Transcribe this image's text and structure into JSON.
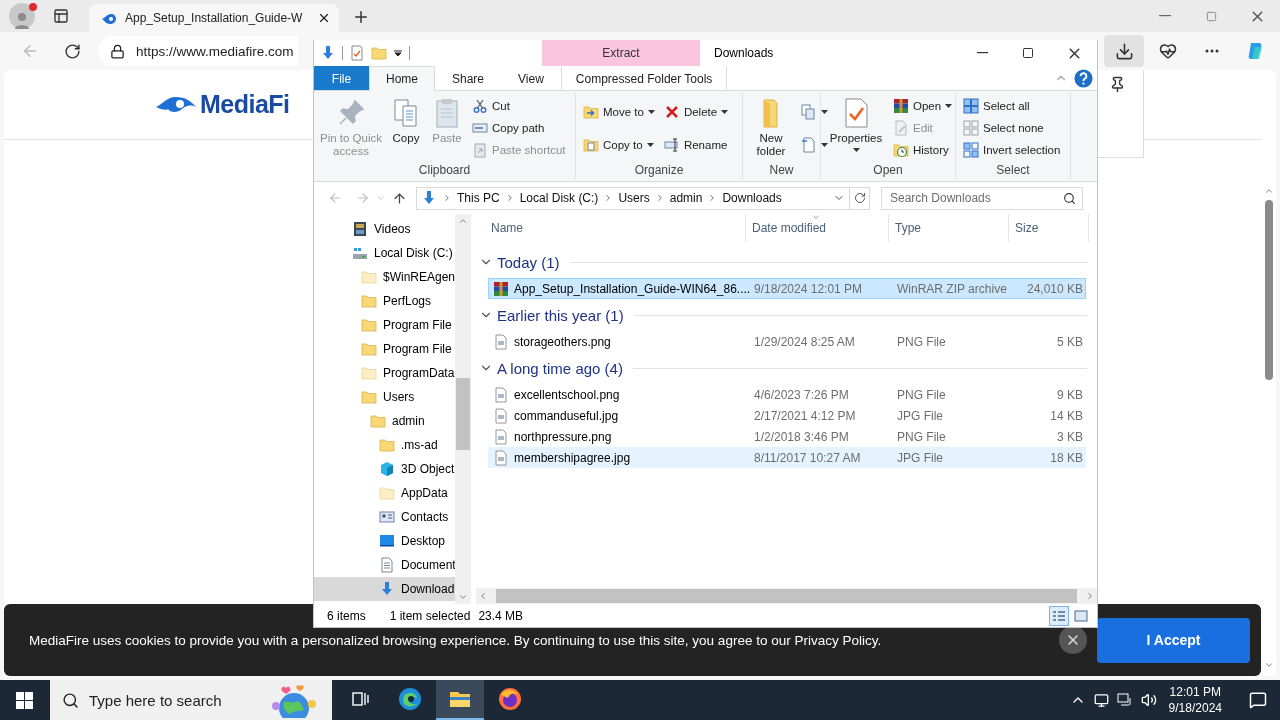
{
  "browser": {
    "tabs": [
      {
        "title": "App_Setup_Installation_Guide-W",
        "selected": true
      }
    ],
    "url": "https://www.mediafire.com"
  },
  "page": {
    "logo": "MediaFi"
  },
  "cookie_banner": {
    "text": "MediaFire uses cookies to provide you with a personalized browsing experience. By continuing to use this site, you agree to our Privacy Policy.",
    "button": "I Accept"
  },
  "explorer": {
    "title": "Downloads",
    "context_group": "Extract",
    "tabs": [
      {
        "label": "File",
        "kind": "file",
        "selected": false
      },
      {
        "label": "Home",
        "kind": "tab",
        "selected": true
      },
      {
        "label": "Share",
        "kind": "tab",
        "selected": false
      },
      {
        "label": "View",
        "kind": "tab",
        "selected": false
      },
      {
        "label": "Compressed Folder Tools",
        "kind": "contextual",
        "selected": false
      }
    ],
    "ribbon": [
      {
        "label": "Clipboard",
        "columns": [
          [
            {
              "kind": "large",
              "label": "Pin to Quick access",
              "disabled": true
            }
          ],
          [
            {
              "kind": "large",
              "label": "Copy",
              "disabled": false
            }
          ],
          [
            {
              "kind": "large",
              "label": "Paste",
              "disabled": true
            }
          ],
          [
            {
              "kind": "small",
              "label": "Cut",
              "disabled": false
            },
            {
              "kind": "small",
              "label": "Copy path",
              "disabled": false
            },
            {
              "kind": "small",
              "label": "Paste shortcut",
              "disabled": true
            }
          ]
        ]
      },
      {
        "label": "Organize",
        "columns": [
          [
            {
              "kind": "small",
              "label": "Move to",
              "disabled": false,
              "dropdown": true
            },
            {
              "kind": "small",
              "label": "Copy to",
              "disabled": false,
              "dropdown": true
            }
          ],
          [
            {
              "kind": "small",
              "label": "Delete",
              "disabled": false,
              "dropdown": true
            },
            {
              "kind": "small",
              "label": "Rename",
              "disabled": false
            }
          ]
        ]
      },
      {
        "label": "New",
        "columns": [
          [
            {
              "kind": "large",
              "label": "New folder",
              "disabled": false
            }
          ],
          [
            {
              "kind": "icon",
              "disabled": false,
              "dropdown": true
            },
            {
              "kind": "icon",
              "disabled": false,
              "dropdown": true
            }
          ]
        ]
      },
      {
        "label": "Open",
        "columns": [
          [
            {
              "kind": "large",
              "label": "Properties",
              "disabled": false,
              "dropdown": true
            }
          ],
          [
            {
              "kind": "small",
              "label": "Open",
              "disabled": false,
              "dropdown": true
            },
            {
              "kind": "small",
              "label": "Edit",
              "disabled": true
            },
            {
              "kind": "small",
              "label": "History",
              "disabled": false
            }
          ]
        ]
      },
      {
        "label": "Select",
        "columns": [
          [
            {
              "kind": "small",
              "label": "Select all",
              "disabled": false
            },
            {
              "kind": "small",
              "label": "Select none",
              "disabled": false
            },
            {
              "kind": "small",
              "label": "Invert selection",
              "disabled": false
            }
          ]
        ]
      }
    ],
    "address": {
      "crumbs": [
        "This PC",
        "Local Disk (C:)",
        "Users",
        "admin",
        "Downloads"
      ],
      "search_placeholder": "Search Downloads"
    },
    "nav": [
      {
        "label": "Videos",
        "kind": "videos",
        "selected": false
      },
      {
        "label": "Local Disk (C:)",
        "kind": "drive",
        "selected": false,
        "children": [
          {
            "label": "$WinREAgen",
            "kind": "folder",
            "hidden": true,
            "selected": false
          },
          {
            "label": "PerfLogs",
            "kind": "folder",
            "hidden": false,
            "selected": false
          },
          {
            "label": "Program File",
            "kind": "folder",
            "hidden": false,
            "selected": false
          },
          {
            "label": "Program File",
            "kind": "folder",
            "hidden": false,
            "selected": false
          },
          {
            "label": "ProgramData",
            "kind": "folder",
            "hidden": true,
            "selected": false
          },
          {
            "label": "Users",
            "kind": "folder",
            "hidden": false,
            "selected": false,
            "children": [
              {
                "label": "admin",
                "kind": "folder",
                "hidden": false,
                "selected": false,
                "children": [
                  {
                    "label": ".ms-ad",
                    "kind": "folder",
                    "hidden": false,
                    "selected": false
                  },
                  {
                    "label": "3D Object",
                    "kind": "objects",
                    "selected": false
                  },
                  {
                    "label": "AppData",
                    "kind": "folder",
                    "hidden": true,
                    "selected": false
                  },
                  {
                    "label": "Contacts",
                    "kind": "contacts",
                    "selected": false
                  },
                  {
                    "label": "Desktop",
                    "kind": "desktop",
                    "selected": false
                  },
                  {
                    "label": "Document",
                    "kind": "documents",
                    "selected": false
                  },
                  {
                    "label": "Download",
                    "kind": "downloads",
                    "selected": true
                  }
                ]
              }
            ]
          }
        ]
      }
    ],
    "columns": [
      "Name",
      "Date modified",
      "Type",
      "Size"
    ],
    "groups": [
      {
        "title": "Today (1)",
        "expanded": true,
        "files": [
          {
            "name": "App_Setup_Installation_Guide-WIN64_86....",
            "date": "9/18/2024 12:01 PM",
            "type": "WinRAR ZIP archive",
            "size": "24,010 KB",
            "kind": "archive",
            "selected": true,
            "hovered": false
          }
        ]
      },
      {
        "title": "Earlier this year (1)",
        "expanded": true,
        "files": [
          {
            "name": "storageothers.png",
            "date": "1/29/2024 8:25 AM",
            "type": "PNG File",
            "size": "5 KB",
            "kind": "image",
            "selected": false,
            "hovered": false
          }
        ]
      },
      {
        "title": "A long time ago (4)",
        "expanded": true,
        "files": [
          {
            "name": "excellentschool.png",
            "date": "4/6/2023 7:26 PM",
            "type": "PNG File",
            "size": "9 KB",
            "kind": "image",
            "selected": false,
            "hovered": false
          },
          {
            "name": "commanduseful.jpg",
            "date": "2/17/2021 4:12 PM",
            "type": "JPG File",
            "size": "14 KB",
            "kind": "image",
            "selected": false,
            "hovered": false
          },
          {
            "name": "northpressure.png",
            "date": "1/2/2018 3:46 PM",
            "type": "PNG File",
            "size": "3 KB",
            "kind": "image",
            "selected": false,
            "hovered": false
          },
          {
            "name": "membershipagree.jpg",
            "date": "8/11/2017 10:27 AM",
            "type": "JPG File",
            "size": "18 KB",
            "kind": "image",
            "selected": false,
            "hovered": true
          }
        ]
      }
    ],
    "status": {
      "count": "6 items",
      "selection": "1 item selected",
      "size": "23.4 MB"
    },
    "views": [
      {
        "kind": "details",
        "selected": true
      },
      {
        "kind": "icons",
        "selected": false
      }
    ]
  },
  "taskbar": {
    "search_placeholder": "Type here to search",
    "apps": [
      {
        "kind": "taskview",
        "active": false
      },
      {
        "kind": "edge",
        "active": false
      },
      {
        "kind": "explorer",
        "active": true
      },
      {
        "kind": "firefox",
        "active": false
      }
    ],
    "time": "12:01 PM",
    "date": "9/18/2024"
  }
}
